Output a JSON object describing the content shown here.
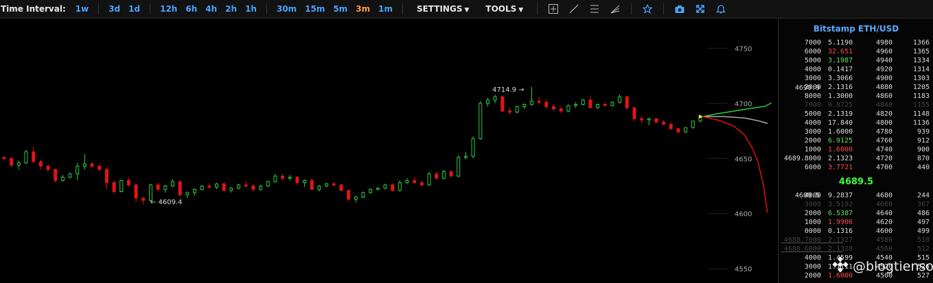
{
  "toolbar": {
    "interval_label": "Time Interval:",
    "intervals": [
      "1w",
      "3d",
      "1d",
      "12h",
      "6h",
      "4h",
      "2h",
      "1h",
      "30m",
      "15m",
      "5m",
      "3m",
      "1m"
    ],
    "active_interval": "3m",
    "settings_label": "SETTINGS",
    "tools_label": "TOOLS"
  },
  "chart_data": {
    "type": "candlestick",
    "y_axis_ticks": [
      4750,
      4700,
      4650,
      4600,
      4550
    ],
    "ylim": [
      4537,
      4777
    ],
    "annotations": {
      "high_label": "4714.9 →",
      "low_label": "← 4609.4"
    },
    "candles": [
      [
        4651,
        4652,
        4648,
        4650
      ],
      [
        4650,
        4651,
        4642,
        4644
      ],
      [
        4644,
        4648,
        4640,
        4646
      ],
      [
        4646,
        4658,
        4645,
        4656
      ],
      [
        4656,
        4661,
        4653,
        4647
      ],
      [
        4647,
        4649,
        4640,
        4643
      ],
      [
        4643,
        4645,
        4638,
        4640
      ],
      [
        4640,
        4641,
        4628,
        4630
      ],
      [
        4630,
        4635,
        4629,
        4633
      ],
      [
        4633,
        4637,
        4632,
        4636
      ],
      [
        4636,
        4646,
        4630,
        4643
      ],
      [
        4643,
        4654,
        4640,
        4645
      ],
      [
        4645,
        4647,
        4641,
        4643
      ],
      [
        4643,
        4645,
        4638,
        4640
      ],
      [
        4640,
        4642,
        4622,
        4628
      ],
      [
        4628,
        4630,
        4618,
        4620
      ],
      [
        4620,
        4631,
        4619,
        4630
      ],
      [
        4630,
        4633,
        4624,
        4626
      ],
      [
        4626,
        4627,
        4610,
        4614
      ],
      [
        4614,
        4615,
        4608,
        4612
      ],
      [
        4612,
        4627,
        4611,
        4626
      ],
      [
        4626,
        4628,
        4620,
        4622
      ],
      [
        4622,
        4626,
        4619,
        4625
      ],
      [
        4625,
        4631,
        4624,
        4629
      ],
      [
        4629,
        4630,
        4616,
        4617
      ],
      [
        4617,
        4620,
        4614,
        4619
      ],
      [
        4619,
        4623,
        4616,
        4622
      ],
      [
        4622,
        4626,
        4621,
        4625
      ],
      [
        4625,
        4627,
        4622,
        4624
      ],
      [
        4624,
        4628,
        4622,
        4627
      ],
      [
        4627,
        4628,
        4620,
        4621
      ],
      [
        4621,
        4624,
        4619,
        4623
      ],
      [
        4623,
        4627,
        4622,
        4626
      ],
      [
        4626,
        4630,
        4624,
        4625
      ],
      [
        4625,
        4627,
        4620,
        4622
      ],
      [
        4622,
        4626,
        4621,
        4625
      ],
      [
        4625,
        4630,
        4624,
        4629
      ],
      [
        4629,
        4636,
        4628,
        4634
      ],
      [
        4634,
        4636,
        4630,
        4632
      ],
      [
        4632,
        4635,
        4630,
        4633
      ],
      [
        4633,
        4634,
        4626,
        4628
      ],
      [
        4628,
        4631,
        4624,
        4630
      ],
      [
        4630,
        4632,
        4621,
        4622
      ],
      [
        4622,
        4626,
        4620,
        4625
      ],
      [
        4625,
        4628,
        4624,
        4627
      ],
      [
        4627,
        4629,
        4624,
        4626
      ],
      [
        4626,
        4627,
        4620,
        4621
      ],
      [
        4621,
        4622,
        4612,
        4613
      ],
      [
        4613,
        4616,
        4610,
        4615
      ],
      [
        4615,
        4620,
        4614,
        4619
      ],
      [
        4619,
        4623,
        4618,
        4622
      ],
      [
        4622,
        4624,
        4621,
        4623
      ],
      [
        4623,
        4627,
        4622,
        4626
      ],
      [
        4626,
        4627,
        4620,
        4621
      ],
      [
        4621,
        4630,
        4620,
        4628
      ],
      [
        4628,
        4632,
        4627,
        4630
      ],
      [
        4630,
        4633,
        4627,
        4628
      ],
      [
        4628,
        4630,
        4625,
        4626
      ],
      [
        4626,
        4638,
        4625,
        4636
      ],
      [
        4636,
        4638,
        4631,
        4632
      ],
      [
        4632,
        4640,
        4631,
        4638
      ],
      [
        4638,
        4639,
        4633,
        4634
      ],
      [
        4634,
        4653,
        4633,
        4651
      ],
      [
        4651,
        4656,
        4649,
        4652
      ],
      [
        4652,
        4670,
        4650,
        4668
      ],
      [
        4668,
        4702,
        4667,
        4700
      ],
      [
        4700,
        4705,
        4697,
        4703
      ],
      [
        4703,
        4708,
        4700,
        4706
      ],
      [
        4706,
        4707,
        4692,
        4693
      ],
      [
        4693,
        4696,
        4690,
        4692
      ],
      [
        4692,
        4698,
        4691,
        4697
      ],
      [
        4697,
        4700,
        4695,
        4699
      ],
      [
        4699,
        4715,
        4698,
        4702
      ],
      [
        4702,
        4706,
        4699,
        4701
      ],
      [
        4701,
        4704,
        4695,
        4697
      ],
      [
        4697,
        4699,
        4693,
        4695
      ],
      [
        4695,
        4697,
        4691,
        4693
      ],
      [
        4693,
        4699,
        4692,
        4698
      ],
      [
        4698,
        4701,
        4696,
        4699
      ],
      [
        4699,
        4704,
        4698,
        4703
      ],
      [
        4703,
        4707,
        4701,
        4696
      ],
      [
        4696,
        4700,
        4695,
        4699
      ],
      [
        4699,
        4701,
        4697,
        4698
      ],
      [
        4698,
        4702,
        4697,
        4701
      ],
      [
        4701,
        4708,
        4700,
        4706
      ],
      [
        4706,
        4707,
        4694,
        4696
      ],
      [
        4696,
        4697,
        4684,
        4686
      ],
      [
        4686,
        4688,
        4682,
        4685
      ],
      [
        4685,
        4687,
        4680,
        4686
      ],
      [
        4686,
        4687,
        4682,
        4683
      ],
      [
        4683,
        4685,
        4680,
        4681
      ],
      [
        4681,
        4683,
        4676,
        4677
      ],
      [
        4677,
        4678,
        4673,
        4674
      ],
      [
        4674,
        4676,
        4673,
        4678
      ],
      [
        4678,
        4683,
        4677,
        4684
      ],
      [
        4684,
        4689,
        4683,
        4688
      ]
    ],
    "lines": [
      {
        "name": "",
        "color": "#2ecc40"
      },
      {
        "name": "",
        "color": "#aaaaaa"
      },
      {
        "name": "",
        "color": "#e01010"
      }
    ]
  },
  "orderbook": {
    "title": "Bitstamp ETH/USD",
    "asks_top_price": "4690.9",
    "asks": [
      {
        "total": "7000",
        "amount": "5.1190",
        "price": "4980",
        "cum": "1366",
        "c": ""
      },
      {
        "total": "6000",
        "amount": "32.651",
        "price": "4960",
        "cum": "1365",
        "c": "red"
      },
      {
        "total": "5000",
        "amount": "3.1987",
        "price": "4940",
        "cum": "1334",
        "c": "green"
      },
      {
        "total": "4000",
        "amount": "0.1417",
        "price": "4920",
        "cum": "1314",
        "c": ""
      },
      {
        "total": "3000",
        "amount": "3.3066",
        "price": "4900",
        "cum": "1303",
        "c": ""
      },
      {
        "total": "2000",
        "amount": "2.1316",
        "price": "4880",
        "cum": "1205",
        "c": ""
      },
      {
        "total": "8000",
        "amount": "1.3000",
        "price": "4860",
        "cum": "1183",
        "c": ""
      },
      {
        "total": "7000",
        "amount": "0.8725",
        "price": "4840",
        "cum": "1155",
        "c": "",
        "faded": true
      },
      {
        "total": "5000",
        "amount": "2.1319",
        "price": "4820",
        "cum": "1148",
        "c": ""
      },
      {
        "total": "4000",
        "amount": "17.840",
        "price": "4800",
        "cum": "1136",
        "c": ""
      },
      {
        "total": "3000",
        "amount": "1.6000",
        "price": "4780",
        "cum": "939",
        "c": ""
      },
      {
        "total": "2000",
        "amount": "6.9125",
        "price": "4760",
        "cum": "912",
        "c": "green"
      },
      {
        "total": "1000",
        "amount": "1.6000",
        "price": "4740",
        "cum": "900",
        "c": "red"
      },
      {
        "total": "4689.8000",
        "amount": "2.1323",
        "price": "4720",
        "cum": "870",
        "c": ""
      },
      {
        "total": "6000",
        "amount": "3.7721",
        "price": "4700",
        "cum": "440",
        "c": "red"
      }
    ],
    "last_price": "4689.5",
    "bids_top_price": "4689.5",
    "bids": [
      {
        "total": "4000",
        "amount": "9.2837",
        "price": "4680",
        "cum": "244",
        "c": ""
      },
      {
        "total": "3000",
        "amount": "3.5192",
        "price": "4660",
        "cum": "367",
        "c": "",
        "faded": true
      },
      {
        "total": "2000",
        "amount": "6.5387",
        "price": "4640",
        "cum": "486",
        "c": "green"
      },
      {
        "total": "1000",
        "amount": "1.9906",
        "price": "4620",
        "cum": "497",
        "c": "red"
      },
      {
        "total": "0000",
        "amount": "0.1316",
        "price": "4600",
        "cum": "499",
        "c": ""
      },
      {
        "total": "4688.7000",
        "amount": "2.1327",
        "price": "4580",
        "cum": "510",
        "c": "",
        "faded": true
      },
      {
        "total": "4688.6000",
        "amount": "2.1328",
        "price": "4560",
        "cum": "512",
        "c": "",
        "faded": true
      },
      {
        "total": "4000",
        "amount": "1.4599",
        "price": "4540",
        "cum": "515",
        "c": ""
      },
      {
        "total": "3000",
        "amount": "1.1111",
        "price": "4520",
        "cum": "526",
        "c": ""
      },
      {
        "total": "2000",
        "amount": "1.6000",
        "price": "4500",
        "cum": "527",
        "c": "red"
      }
    ]
  },
  "watermark": {
    "text": "@blogtienso",
    "icon": "binance-logo"
  }
}
